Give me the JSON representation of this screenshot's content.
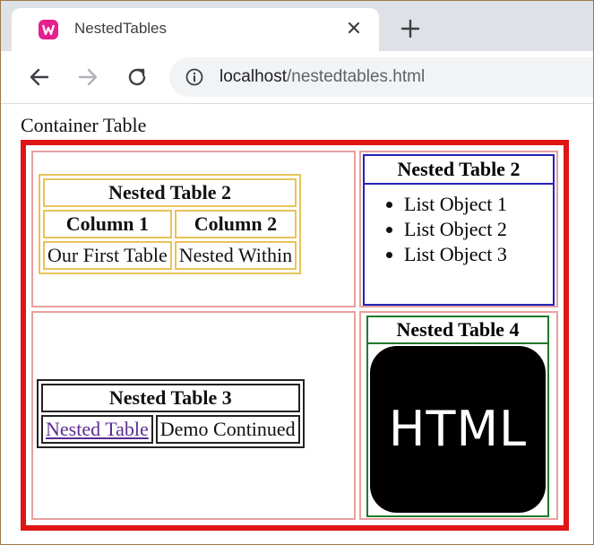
{
  "browser": {
    "tab_title": "NestedTables",
    "url_host": "localhost",
    "url_path": "/nestedtables.html"
  },
  "page": {
    "caption": "Container Table",
    "nested_table_1": {
      "title": "Nested Table 2",
      "columns": [
        "Column 1",
        "Column 2"
      ],
      "row": [
        "Our First Table",
        "Nested Within"
      ]
    },
    "nested_table_2": {
      "title": "Nested Table 2",
      "items": [
        "List Object 1",
        "List Object 2",
        "List Object 3"
      ]
    },
    "nested_table_3": {
      "title": "Nested Table 3",
      "link_text": "Nested Table",
      "cell_text": "Demo Continued"
    },
    "nested_table_4": {
      "title": "Nested Table 4",
      "logo_text": "HTML"
    }
  },
  "colors": {
    "container_border": "#e01515",
    "table1_border": "#e7c35a",
    "table2_border": "#2323b8",
    "table3_border": "#222222",
    "table4_border": "#1f7a2a",
    "link": "#5b2d91"
  }
}
